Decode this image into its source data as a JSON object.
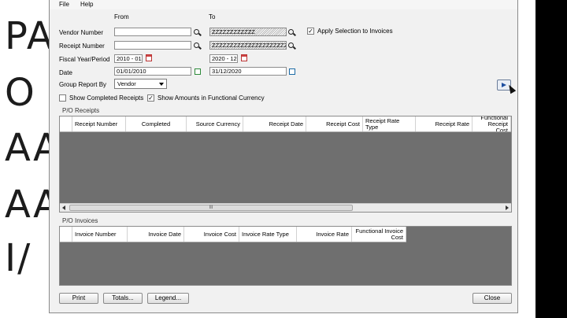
{
  "slide": {
    "letters": [
      "PA",
      "O",
      "AA",
      "AA",
      "I/"
    ]
  },
  "menu": {
    "file": "File",
    "help": "Help"
  },
  "form": {
    "from_label": "From",
    "to_label": "To",
    "vendor_number_label": "Vendor Number",
    "receipt_number_label": "Receipt Number",
    "fiscal_label": "Fiscal Year/Period",
    "date_label": "Date",
    "group_report_label": "Group Report By",
    "vendor_from": "",
    "vendor_to": "ZZZZZZZZZZZZ",
    "receipt_from": "",
    "receipt_to": "ZZZZZZZZZZZZZZZZZZZZZZ",
    "fiscal_from": "2010 - 01",
    "fiscal_to": "2020 - 12",
    "date_from": "01/01/2010",
    "date_to": "31/12/2020",
    "group_by_value": "Vendor",
    "apply_selection_label": "Apply Selection to Invoices",
    "apply_selection_checked": "✓",
    "show_completed_label": "Show Completed Receipts",
    "show_completed_checked": "",
    "show_functional_label": "Show Amounts in Functional Currency",
    "show_functional_checked": "✓"
  },
  "receipts": {
    "title": "P/O Receipts",
    "columns": [
      "Receipt Number",
      "Completed",
      "Source Currency",
      "Receipt Date",
      "Receipt Cost",
      "Receipt Rate Type",
      "Receipt Rate",
      "Functional Receipt Cost"
    ],
    "scroll_thumb": "III"
  },
  "invoices": {
    "title": "P/O Invoices",
    "columns": [
      "Invoice Number",
      "Invoice Date",
      "Invoice Cost",
      "Invoice Rate Type",
      "Invoice Rate",
      "Functional Invoice Cost"
    ]
  },
  "buttons": {
    "print": "Print",
    "totals": "Totals...",
    "legend": "Legend...",
    "close": "Close"
  },
  "icons": {
    "finder": "search-icon",
    "calendar": "calendar-icon",
    "go": "go-arrow-icon"
  }
}
